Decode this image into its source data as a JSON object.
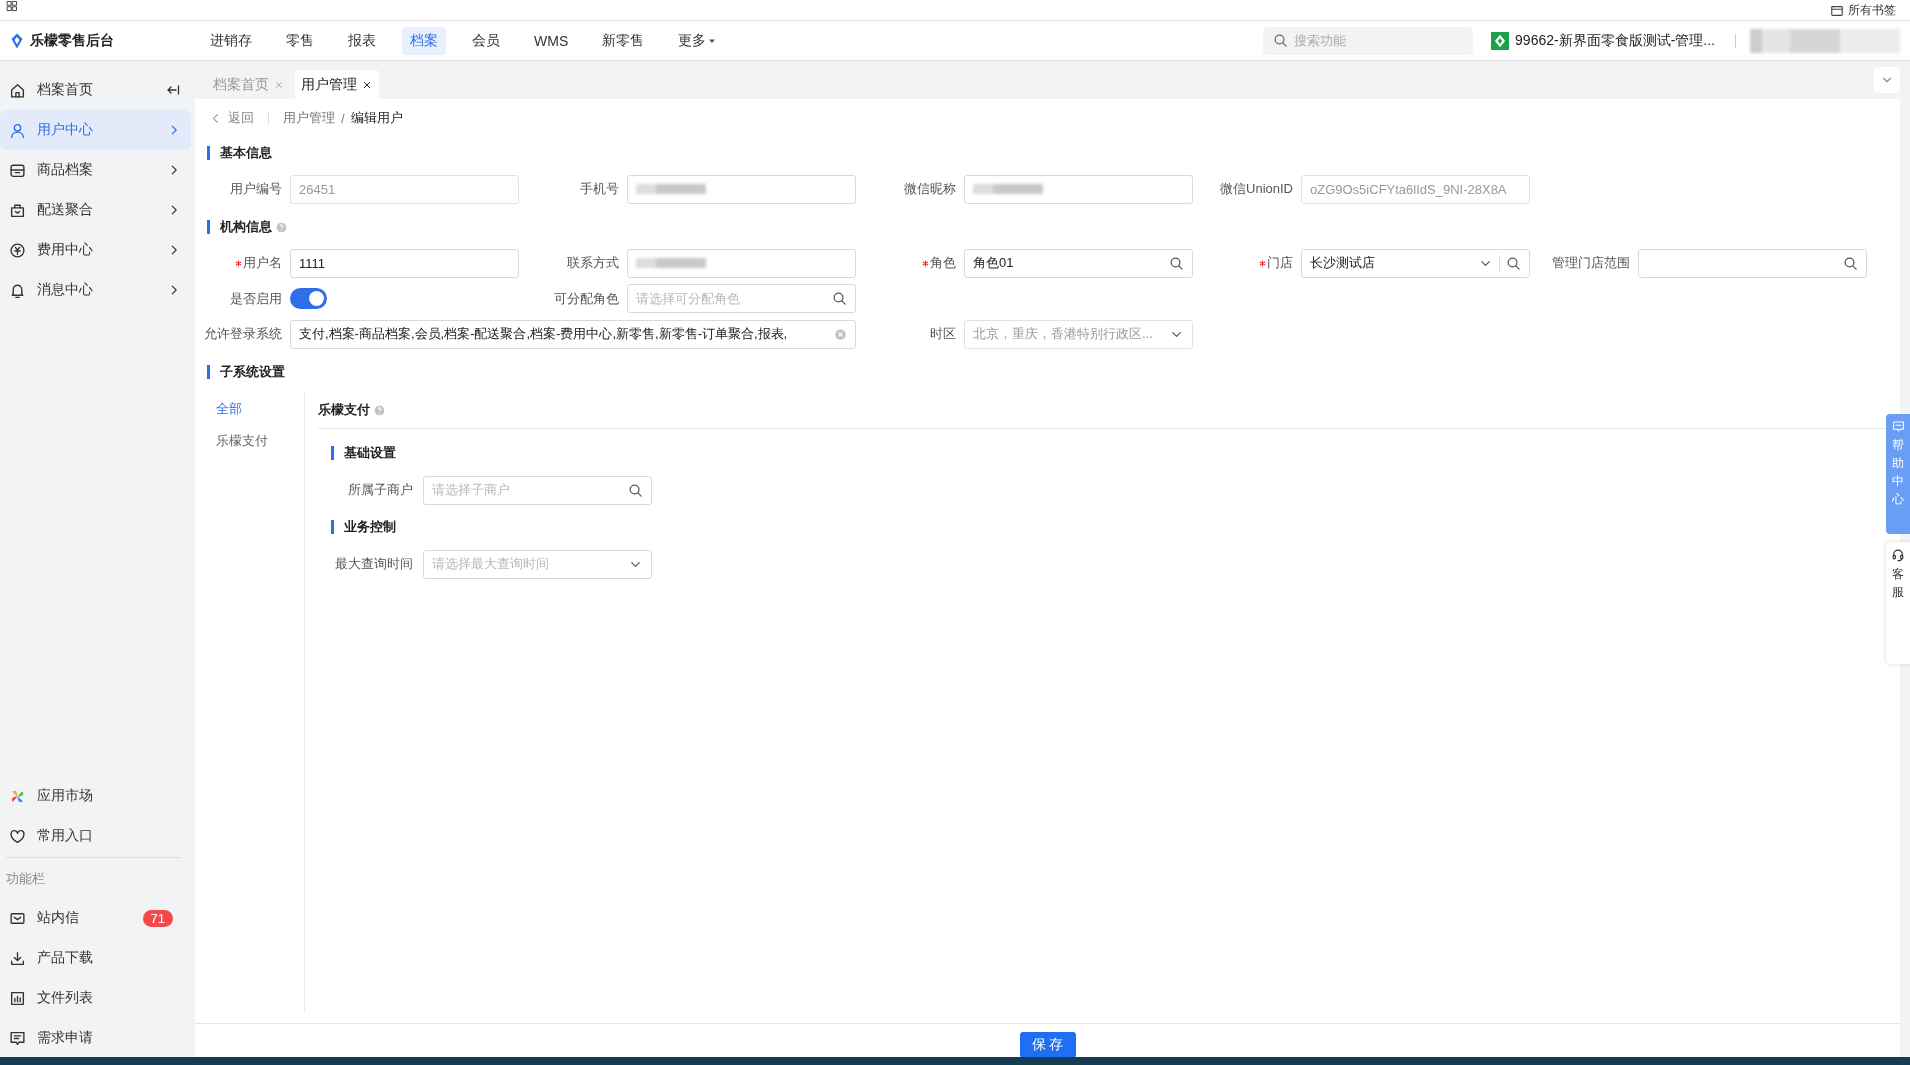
{
  "browser_bar": {
    "bookmarks": "所有书签"
  },
  "header": {
    "logo": "乐檬零售后台",
    "nav": [
      {
        "label": "进销存",
        "selected": false,
        "kind": "link"
      },
      {
        "label": "零售",
        "selected": false,
        "kind": "link"
      },
      {
        "label": "报表",
        "selected": false,
        "kind": "link"
      },
      {
        "label": "档案",
        "selected": true,
        "kind": "link"
      },
      {
        "label": "会员",
        "selected": false,
        "kind": "link"
      },
      {
        "label": "WMS",
        "selected": false,
        "kind": "link"
      },
      {
        "label": "新零售",
        "selected": false,
        "kind": "link"
      },
      {
        "label": "更多",
        "selected": false,
        "kind": "dropdown"
      }
    ],
    "search": {
      "placeholder": "搜索功能"
    },
    "store": "99662-新界面零食版测试-管理..."
  },
  "tabs": [
    {
      "label": "档案首页",
      "selected": false
    },
    {
      "label": "用户管理",
      "selected": true
    }
  ],
  "sidebar": {
    "items": [
      {
        "label": "档案首页",
        "selected": false,
        "kind": "collapse"
      },
      {
        "label": "用户中心",
        "selected": true,
        "kind": "group"
      },
      {
        "label": "商品档案",
        "selected": false,
        "kind": "group"
      },
      {
        "label": "配送聚合",
        "selected": false,
        "kind": "group"
      },
      {
        "label": "费用中心",
        "selected": false,
        "kind": "group"
      },
      {
        "label": "消息中心",
        "selected": false,
        "kind": "group"
      }
    ],
    "shortcuts": [
      "应用市场",
      "常用入口"
    ],
    "toolbar_title": "功能栏",
    "toolbar": [
      {
        "label": "站内信",
        "badge": "71"
      },
      {
        "label": "产品下载"
      },
      {
        "label": "文件列表"
      },
      {
        "label": "需求申请"
      }
    ]
  },
  "breadcrumb": {
    "back": "返回",
    "separator": "/",
    "path": [
      "用户管理",
      "编辑用户"
    ]
  },
  "sections": [
    {
      "title": "基本信息",
      "rows": [
        [
          {
            "label": "用户编号",
            "kind": "text",
            "value": "26451",
            "disabled": true,
            "required": false
          },
          {
            "label": "手机号",
            "kind": "blurred",
            "required": false
          },
          {
            "label": "微信昵称",
            "kind": "blurred",
            "required": false
          },
          {
            "label": "微信UnionID",
            "kind": "text",
            "value": "oZG9Os5iCFYta6lIdS_9NI-28X8A",
            "disabled": true,
            "required": false
          }
        ]
      ]
    },
    {
      "title": "机构信息",
      "help": true,
      "rows": [
        [
          {
            "label": "用户名",
            "kind": "text",
            "value": "1111",
            "disabled": false,
            "required": true
          },
          {
            "label": "联系方式",
            "kind": "blurred",
            "required": false
          },
          {
            "label": "角色",
            "kind": "search",
            "value": "角色01",
            "disabled": false,
            "required": true
          },
          {
            "label": "门店",
            "kind": "select-search",
            "value": "长沙测试店",
            "disabled": false,
            "required": true
          },
          {
            "label": "管理门店范围",
            "kind": "search",
            "required": false
          }
        ],
        [
          {
            "label": "是否启用",
            "kind": "toggle",
            "on": true,
            "required": false
          },
          {
            "label": "可分配角色",
            "kind": "search",
            "placeholder": "请选择可分配角色",
            "required": false
          }
        ],
        [
          {
            "label": "允许登录系统",
            "kind": "tags",
            "value": "支付,档案-商品档案,会员,档案-配送聚合,档案-费用中心,新零售,新零售-订单聚合,报表,",
            "disabled": false,
            "required": false
          },
          "",
          {
            "label": "时区",
            "kind": "select",
            "value": "北京，重庆，香港特别行政区...",
            "disabled": true,
            "required": false
          }
        ]
      ]
    }
  ],
  "subsystem": {
    "title": "子系统设置",
    "nav": [
      {
        "label": "全部",
        "selected": true
      },
      {
        "label": "乐檬支付",
        "selected": false
      }
    ],
    "panel": {
      "title": "乐檬支付",
      "help": true,
      "groups": [
        {
          "title": "基础设置",
          "fields": [
            {
              "label": "所属子商户",
              "kind": "search",
              "placeholder": "请选择子商户",
              "required": false
            }
          ]
        },
        {
          "title": "业务控制",
          "fields": [
            {
              "label": "最大查询时间",
              "kind": "select",
              "placeholder": "请选择最大查询时间",
              "required": false
            }
          ]
        }
      ]
    }
  },
  "footer": {
    "save": "保 存"
  },
  "float": {
    "help": "帮助中心",
    "service": "客服"
  }
}
